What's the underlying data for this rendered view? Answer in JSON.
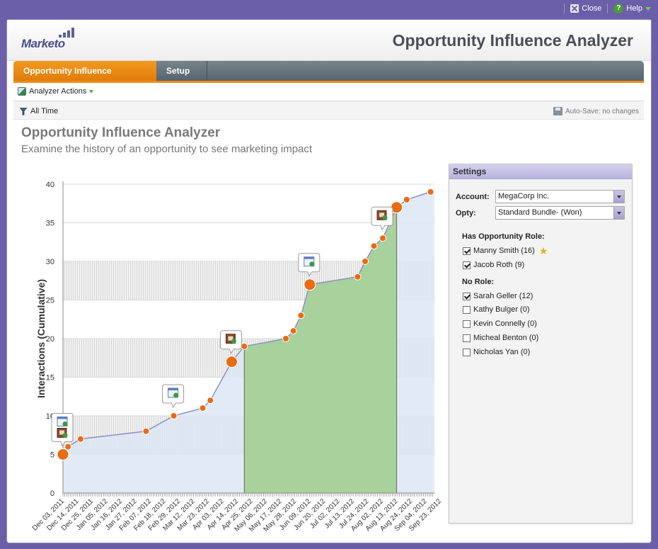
{
  "topbar": {
    "close_label": "Close",
    "help_label": "Help"
  },
  "header": {
    "logo_text": "Marketo",
    "app_title": "Opportunity Influence Analyzer"
  },
  "tabs": [
    {
      "label": "Opportunity Influence Analyzer",
      "active": true
    },
    {
      "label": "Setup",
      "active": false
    }
  ],
  "actions": {
    "label": "Analyzer Actions"
  },
  "subbar": {
    "time_filter": "All Time",
    "autosave": "Auto-Save: no changes"
  },
  "page": {
    "title": "Opportunity Influence Analyzer",
    "subtitle": "Examine the history of an opportunity to see marketing impact"
  },
  "settings": {
    "title": "Settings",
    "account_label": "Account:",
    "account_value": "MegaCorp Inc.",
    "opty_label": "Opty:",
    "opty_value": "Standard Bundle- (Won)",
    "role_heading": "Has Opportunity Role:",
    "role_people": [
      {
        "label": "Manny Smith (16)",
        "checked": true,
        "star": true
      },
      {
        "label": "Jacob Roth (9)",
        "checked": true,
        "star": false
      }
    ],
    "norole_heading": "No Role:",
    "norole_people": [
      {
        "label": "Sarah Geller (12)",
        "checked": true
      },
      {
        "label": "Kathy Bulger (0)",
        "checked": false
      },
      {
        "label": "Kevin Connelly (0)",
        "checked": false
      },
      {
        "label": "Micheal Benton (0)",
        "checked": false
      },
      {
        "label": "Nicholas Yan (0)",
        "checked": false
      }
    ]
  },
  "chart_data": {
    "type": "area",
    "ylabel": "Interactions (Cumulative)",
    "ylim": [
      0,
      40
    ],
    "yticks": [
      0,
      5,
      10,
      15,
      20,
      25,
      30,
      35,
      40
    ],
    "xlim": [
      "Dec 03, 2011",
      "Sep 23, 2012"
    ],
    "xtick_labels": [
      "Dec 03, 2011",
      "Dec 14, 2011",
      "Dec 25, 2011",
      "Jan 05, 2012",
      "Jan 16, 2012",
      "Jan 27, 2012",
      "Feb 07, 2012",
      "Feb 18, 2012",
      "Feb 29, 2012",
      "Mar 12, 2012",
      "Mar 23, 2012",
      "Apr 03, 2012",
      "Apr 14, 2012",
      "Apr 25, 2012",
      "May 06, 2012",
      "May 17, 2012",
      "May 28, 2012",
      "Jun 09, 2012",
      "Jun 20, 2012",
      "Jul 02, 2012",
      "Jul 13, 2012",
      "Jul 24, 2012",
      "Aug 02, 2012",
      "Aug 13, 2012",
      "Aug 24, 2012",
      "Sep 04, 2012",
      "Sep 23, 2012"
    ],
    "opportunity_window": [
      "Apr 25, 2012",
      "Aug 24, 2012"
    ],
    "points": [
      {
        "x": "Dec 03, 2011",
        "y": 5,
        "major": true
      },
      {
        "x": "Dec 07, 2011",
        "y": 6
      },
      {
        "x": "Dec 17, 2011",
        "y": 7
      },
      {
        "x": "Feb 07, 2012",
        "y": 8
      },
      {
        "x": "Feb 29, 2012",
        "y": 10
      },
      {
        "x": "Mar 23, 2012",
        "y": 11
      },
      {
        "x": "Mar 29, 2012",
        "y": 12
      },
      {
        "x": "Apr 15, 2012",
        "y": 17,
        "major": true
      },
      {
        "x": "Apr 25, 2012",
        "y": 19
      },
      {
        "x": "May 28, 2012",
        "y": 20
      },
      {
        "x": "Jun 03, 2012",
        "y": 21
      },
      {
        "x": "Jun 09, 2012",
        "y": 23
      },
      {
        "x": "Jun 16, 2012",
        "y": 27,
        "major": true
      },
      {
        "x": "Jul 24, 2012",
        "y": 28
      },
      {
        "x": "Jul 30, 2012",
        "y": 30
      },
      {
        "x": "Aug 06, 2012",
        "y": 32
      },
      {
        "x": "Aug 13, 2012",
        "y": 33
      },
      {
        "x": "Aug 24, 2012",
        "y": 37,
        "major": true
      },
      {
        "x": "Sep 01, 2012",
        "y": 38
      },
      {
        "x": "Sep 20, 2012",
        "y": 39
      }
    ],
    "callouts": [
      {
        "x": "Dec 03, 2011",
        "y": 5,
        "icons": [
          "calendar-icon",
          "lead-icon"
        ]
      },
      {
        "x": "Feb 29, 2012",
        "y": 10,
        "icons": [
          "calendar-icon"
        ]
      },
      {
        "x": "Apr 15, 2012",
        "y": 17,
        "icons": [
          "lead-icon"
        ]
      },
      {
        "x": "Jun 16, 2012",
        "y": 27,
        "icons": [
          "calendar-icon"
        ]
      },
      {
        "x": "Aug 13, 2012",
        "y": 33,
        "icons": [
          "lead-icon"
        ]
      }
    ],
    "colors": {
      "pre_area": "#dde6f3",
      "opportunity_area": "#a8d19b",
      "line": "#8f8ec4",
      "point": "#e96b12",
      "band": "#e9e9e9"
    }
  }
}
